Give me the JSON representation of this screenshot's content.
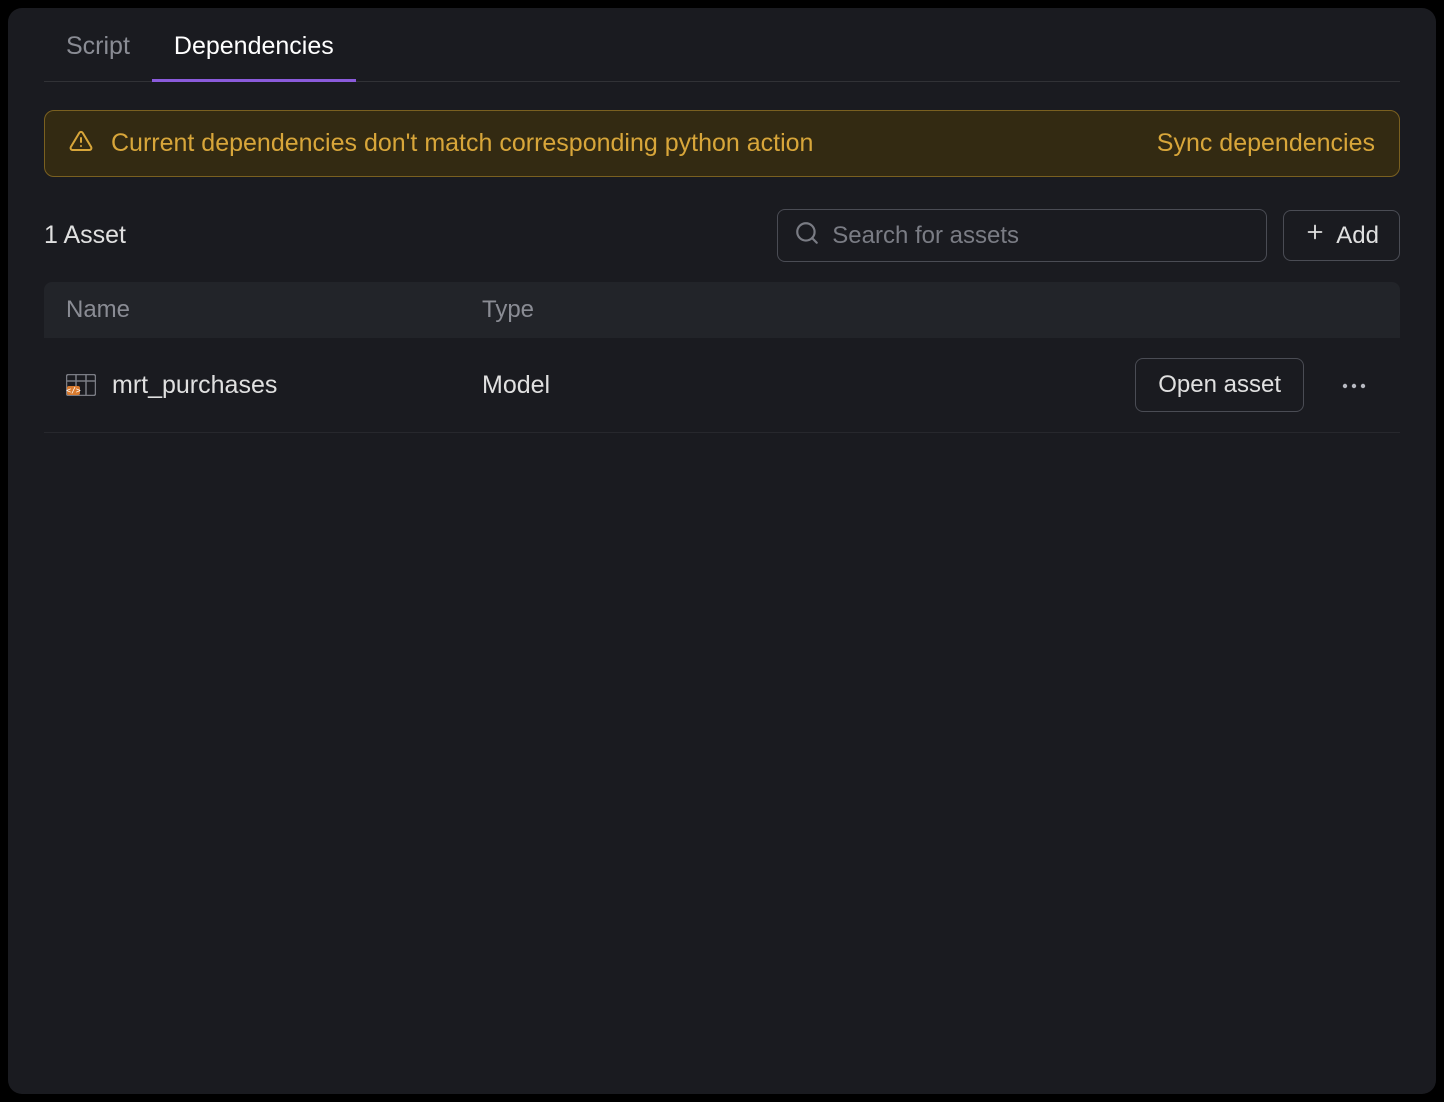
{
  "tabs": [
    {
      "label": "Script",
      "active": false
    },
    {
      "label": "Dependencies",
      "active": true
    }
  ],
  "banner": {
    "message": "Current dependencies don't match corresponding python action",
    "action_label": "Sync dependencies"
  },
  "toolbar": {
    "asset_count_label": "1 Asset",
    "search_placeholder": "Search for assets",
    "add_label": "Add"
  },
  "table": {
    "headers": {
      "name": "Name",
      "type": "Type"
    },
    "rows": [
      {
        "name": "mrt_purchases",
        "type": "Model",
        "open_label": "Open asset"
      }
    ]
  }
}
